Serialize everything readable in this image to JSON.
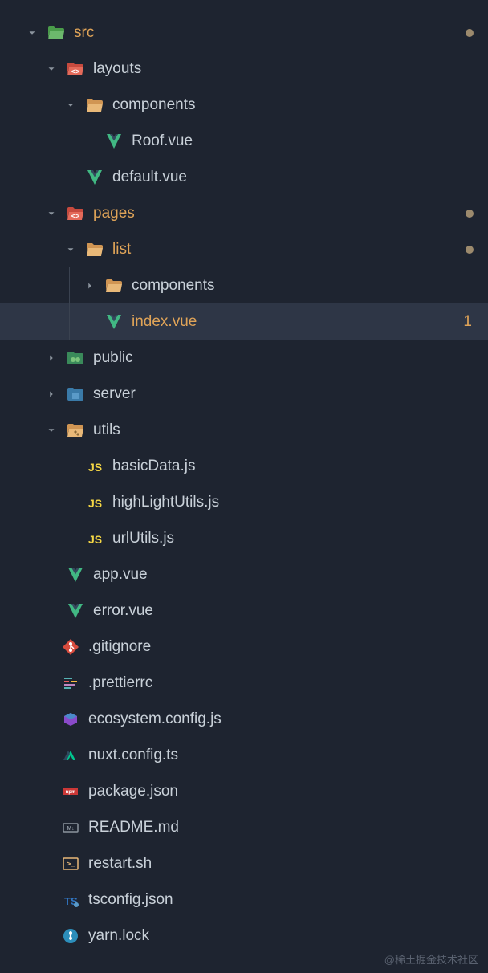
{
  "tree": {
    "src": "src",
    "layouts": "layouts",
    "components1": "components",
    "roof": "Roof.vue",
    "default": "default.vue",
    "pages": "pages",
    "list": "list",
    "components2": "components",
    "index": "index.vue",
    "indexBadge": "1",
    "public": "public",
    "server": "server",
    "utils": "utils",
    "basicData": "basicData.js",
    "highLight": "highLightUtils.js",
    "urlUtils": "urlUtils.js",
    "app": "app.vue",
    "error": "error.vue",
    "gitignore": ".gitignore",
    "prettierrc": ".prettierrc",
    "ecosystem": "ecosystem.config.js",
    "nuxtconfig": "nuxt.config.ts",
    "packagejson": "package.json",
    "readme": "README.md",
    "restart": "restart.sh",
    "tsconfig": "tsconfig.json",
    "yarnlock": "yarn.lock"
  },
  "watermark": "@稀土掘金技术社区"
}
